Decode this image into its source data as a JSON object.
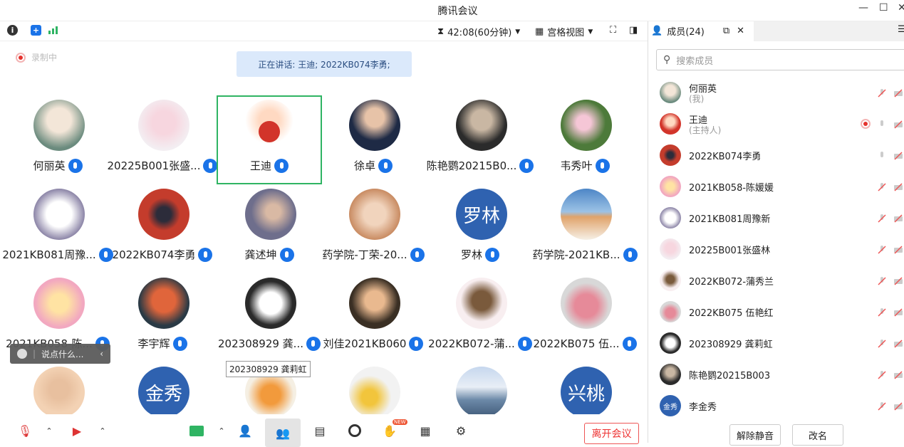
{
  "window": {
    "title": "腾讯会议"
  },
  "toolbar": {
    "timer": "42:08(60分钟)",
    "view": "宫格视图"
  },
  "recording": {
    "label": "录制中"
  },
  "speaking": {
    "text": "正在讲话: 王迪; 2022KB074李勇;"
  },
  "tiles": [
    {
      "name": "何丽英"
    },
    {
      "name": "20225B001张盛..."
    },
    {
      "name": "王迪"
    },
    {
      "name": "徐卓"
    },
    {
      "name": "陈艳鹦20215B0..."
    },
    {
      "name": "韦秀叶"
    },
    {
      "name": "2021KB081周豫..."
    },
    {
      "name": "2022KB074李勇"
    },
    {
      "name": "龚述坤"
    },
    {
      "name": "药学院-丁荣-20..."
    },
    {
      "name": "罗林",
      "avatar_text": "罗林"
    },
    {
      "name": "药学院-2021KB..."
    },
    {
      "name": "2021KB058-陈..."
    },
    {
      "name": "李宇辉"
    },
    {
      "name": "202308929 龚..."
    },
    {
      "name": "刘佳2021KB060"
    },
    {
      "name": "2022KB072-蒲..."
    },
    {
      "name": "2022KB075 伍..."
    },
    {
      "name": ""
    },
    {
      "name": "",
      "avatar_text": "金秀"
    },
    {
      "name": ""
    },
    {
      "name": ""
    },
    {
      "name": ""
    },
    {
      "name": "",
      "avatar_text": "兴桃"
    }
  ],
  "chat": {
    "placeholder": "说点什么..."
  },
  "tooltip": {
    "text": "202308929 龚莉虹"
  },
  "bottom": {
    "leave": "离开会议",
    "new_badge": "NEW"
  },
  "panel": {
    "tab_label": "成员(24)",
    "search_placeholder": "搜索成员",
    "members": [
      {
        "name": "何丽英",
        "sub": "(我)"
      },
      {
        "name": "王迪",
        "sub": "(主持人)"
      },
      {
        "name": "2022KB074李勇"
      },
      {
        "name": "2021KB058-陈媛媛"
      },
      {
        "name": "2021KB081周豫新"
      },
      {
        "name": "20225B001张盛林"
      },
      {
        "name": "2022KB072-蒲秀兰"
      },
      {
        "name": "2022KB075 伍艳红"
      },
      {
        "name": "202308929 龚莉虹"
      },
      {
        "name": "陈艳鹦20215B003"
      },
      {
        "name": "李金秀",
        "avatar_text": "金秀"
      }
    ],
    "unmute_all": "解除静音",
    "rename": "改名"
  },
  "colors": {
    "accent": "#1a73e8",
    "active_border": "#2fb463",
    "leave": "#e33333"
  }
}
